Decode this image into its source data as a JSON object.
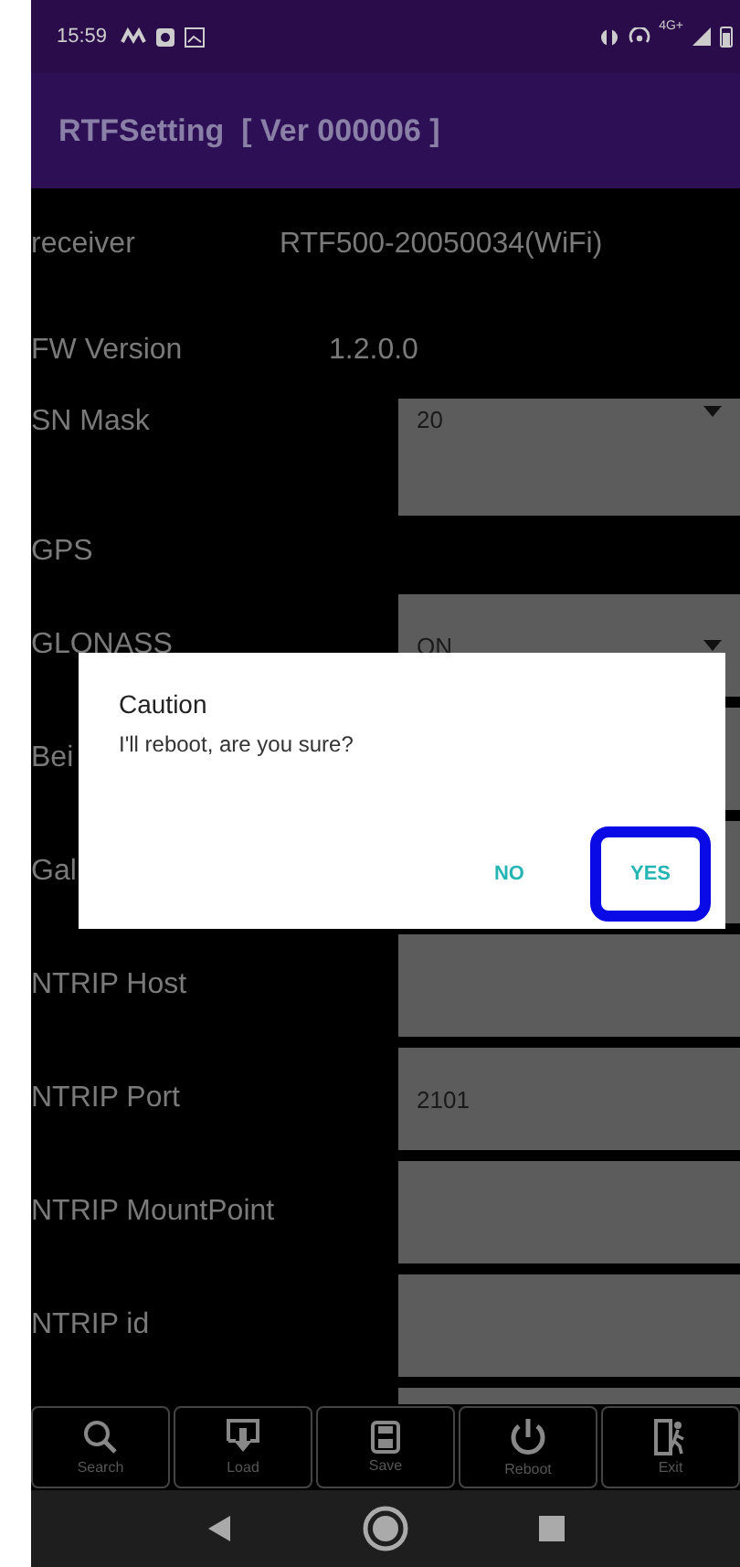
{
  "status_bar": {
    "time": "15:59",
    "network": "4G+"
  },
  "app_bar": {
    "title": "RTFSetting  [ Ver 000006 ]"
  },
  "settings": [
    {
      "label": "receiver",
      "kind": "info",
      "value": "RTF500-20050034(WiFi)"
    },
    {
      "label": "FW Version",
      "kind": "info",
      "value": "1.2.0.0"
    },
    {
      "label": "SN Mask",
      "kind": "dropdown",
      "value": "20"
    },
    {
      "label": "GPS",
      "kind": "none"
    },
    {
      "label": "GLONASS",
      "kind": "dropdown",
      "value": "ON"
    },
    {
      "label": "Bei",
      "kind": "field"
    },
    {
      "label": "Gal",
      "kind": "field"
    },
    {
      "label": "NTRIP Host",
      "kind": "field"
    },
    {
      "label": "NTRIP Port",
      "kind": "field",
      "value": "2101"
    },
    {
      "label": "NTRIP MountPoint",
      "kind": "field"
    },
    {
      "label": "NTRIP id",
      "kind": "field"
    },
    {
      "kind": "field"
    }
  ],
  "dialog": {
    "title": "Caution",
    "message": "I'll reboot, are you sure?",
    "buttons": [
      {
        "label": "NO",
        "highlighted": false
      },
      {
        "label": "YES",
        "highlighted": true
      }
    ]
  },
  "toolbar": [
    {
      "label": "Search",
      "kind": "search"
    },
    {
      "label": "Load",
      "kind": "load"
    },
    {
      "label": "Save",
      "kind": "save"
    },
    {
      "label": "Reboot",
      "kind": "power"
    },
    {
      "label": "Exit",
      "kind": "exit"
    }
  ]
}
